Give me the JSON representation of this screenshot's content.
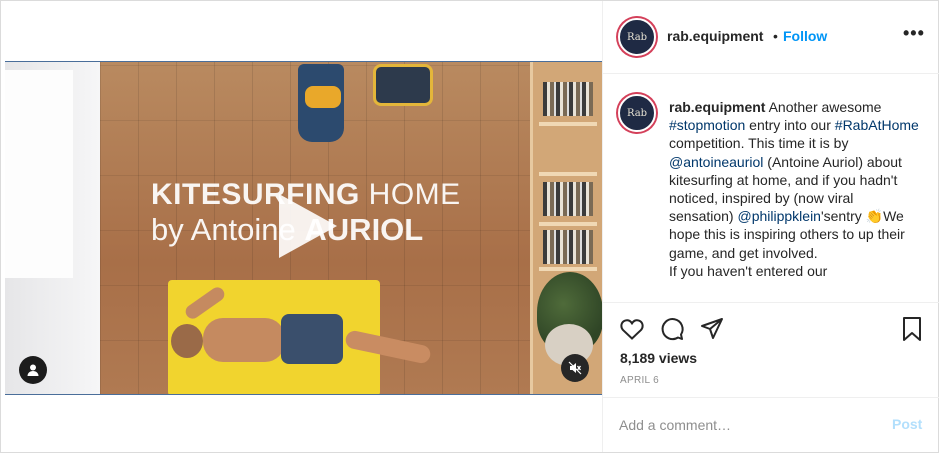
{
  "post": {
    "username": "rab.equipment",
    "follow_label": "Follow",
    "separator": "•",
    "more_label": "•••",
    "avatar_text": "Rab"
  },
  "video": {
    "title_line1_bold": "KITESURFING",
    "title_line1_rest": " HOME",
    "title_line2_rest": "by Antoine ",
    "title_line2_bold": "AURIOL",
    "play_icon": "play-icon",
    "user_tag_icon": "user-icon",
    "mute_icon": "speaker-muted-icon"
  },
  "caption": {
    "username": "rab.equipment",
    "text_1": " Another awesome ",
    "hashtag_1": "#stopmotion",
    "text_2": " entry into our ",
    "hashtag_2": "#RabAtHome",
    "text_3": " competition. This time it is by ",
    "mention_1": "@antoineauriol",
    "text_4": " (Antoine Auriol) about kitesurfing at home, and if you hadn't noticed, inspired by (now viral sensation) ",
    "mention_2": "@philippklein",
    "text_5": "'sentry 👏We hope this is inspiring others to up their game, and get involved.",
    "text_6": "If you haven't entered our"
  },
  "actions": {
    "like_icon": "heart-icon",
    "comment_icon": "comment-icon",
    "share_icon": "share-icon",
    "save_icon": "bookmark-icon",
    "views": "8,189 views",
    "date": "APRIL 6"
  },
  "comment": {
    "placeholder": "Add a comment…",
    "post_label": "Post"
  },
  "colors": {
    "link": "#00376b",
    "follow": "#0095f6",
    "post_disabled": "#b2dffc"
  }
}
